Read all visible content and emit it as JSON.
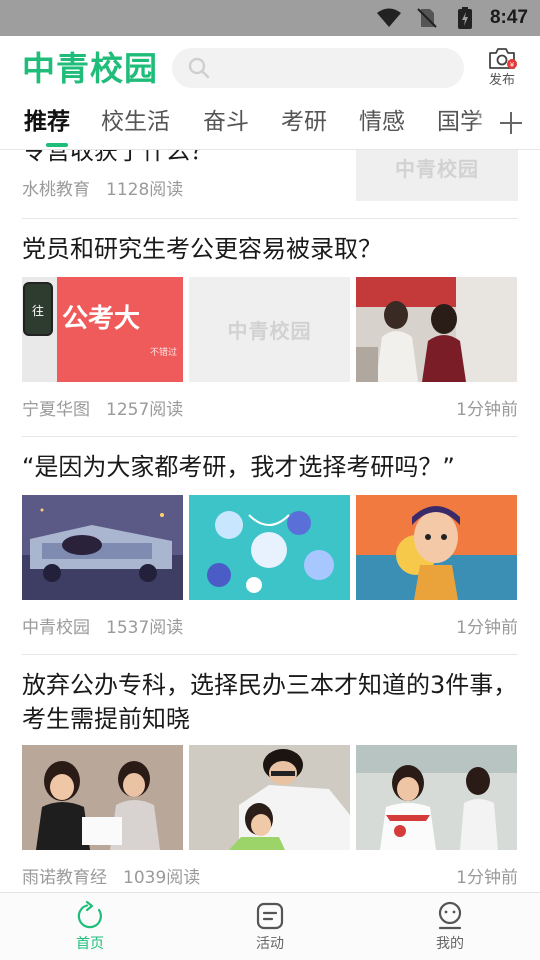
{
  "status_bar": {
    "time": "8:47"
  },
  "header": {
    "logo": "中青校园",
    "search_placeholder": "",
    "publish_label": "发布"
  },
  "tabs": [
    {
      "label": "推荐",
      "active": true
    },
    {
      "label": "校生活"
    },
    {
      "label": "奋斗"
    },
    {
      "label": "考研"
    },
    {
      "label": "情感"
    },
    {
      "label": "国学"
    }
  ],
  "placeholder_logo": "中青校园",
  "feed": [
    {
      "title": "令营收获了什么？",
      "source": "水桃教育",
      "reads": "1128阅读",
      "time": ""
    },
    {
      "title": "党员和研究生考公更容易被录取？",
      "source": "宁夏华图",
      "reads": "1257阅读",
      "time": "1分钟前",
      "image_text": {
        "title": "公考大",
        "sub": "不错过"
      }
    },
    {
      "title": "“是因为大家都考研，我才选择考研吗？”",
      "source": "中青校园",
      "reads": "1537阅读",
      "time": "1分钟前"
    },
    {
      "title": "放弃公办专科，选择民办三本才知道的3件事，考生需提前知晓",
      "source": "雨诺教育经",
      "reads": "1039阅读",
      "time": "1分钟前"
    }
  ],
  "bottom_nav": [
    {
      "label": "首页",
      "icon": "refresh-icon",
      "active": true
    },
    {
      "label": "活动",
      "icon": "note-icon"
    },
    {
      "label": "我的",
      "icon": "profile-icon"
    }
  ],
  "colors": {
    "accent": "#1fbd79",
    "status_bar": "#9e9e9e",
    "meta_text": "#9a9a9a"
  }
}
